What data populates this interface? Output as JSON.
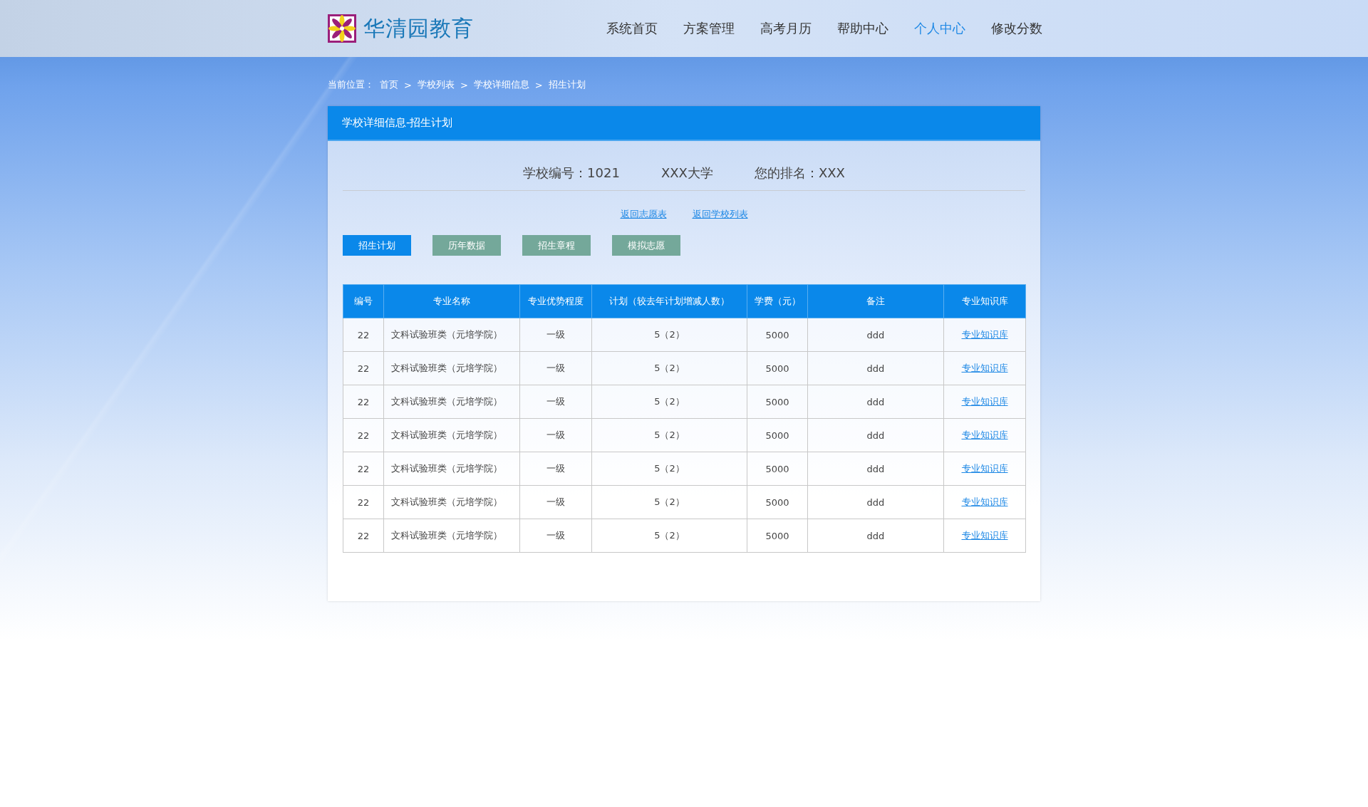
{
  "brand": {
    "name": "华清园教育"
  },
  "nav": [
    {
      "label": "系统首页",
      "selected": false
    },
    {
      "label": "方案管理",
      "selected": false
    },
    {
      "label": "高考月历",
      "selected": false
    },
    {
      "label": "帮助中心",
      "selected": false
    },
    {
      "label": "个人中心",
      "selected": true
    },
    {
      "label": "修改分数",
      "selected": false
    }
  ],
  "breadcrumb": {
    "prefix": "当前位置：",
    "items": [
      "首页",
      "学校列表",
      "学校详细信息",
      "招生计划"
    ],
    "separator": ">"
  },
  "panel": {
    "title": "学校详细信息-招生计划",
    "info": [
      "学校编号：1021",
      "XXX大学",
      "您的排名：XXX"
    ],
    "links": [
      "返回志愿表",
      "返回学校列表"
    ],
    "tabs": [
      {
        "label": "招生计划",
        "selected": true
      },
      {
        "label": "历年数据",
        "selected": false
      },
      {
        "label": "招生章程",
        "selected": false
      },
      {
        "label": "模拟志愿",
        "selected": false
      }
    ],
    "table": {
      "columns": [
        "编号",
        "专业名称",
        "专业优势程度",
        "计划（较去年计划增减人数）",
        "学费（元）",
        "备注",
        "专业知识库"
      ],
      "rows": [
        [
          "22",
          "文科试验班类（元培学院）",
          "一级",
          "5（2）",
          "5000",
          "ddd",
          "专业知识库"
        ],
        [
          "22",
          "文科试验班类（元培学院）",
          "一级",
          "5（2）",
          "5000",
          "ddd",
          "专业知识库"
        ],
        [
          "22",
          "文科试验班类（元培学院）",
          "一级",
          "5（2）",
          "5000",
          "ddd",
          "专业知识库"
        ],
        [
          "22",
          "文科试验班类（元培学院）",
          "一级",
          "5（2）",
          "5000",
          "ddd",
          "专业知识库"
        ],
        [
          "22",
          "文科试验班类（元培学院）",
          "一级",
          "5（2）",
          "5000",
          "ddd",
          "专业知识库"
        ],
        [
          "22",
          "文科试验班类（元培学院）",
          "一级",
          "5（2）",
          "5000",
          "ddd",
          "专业知识库"
        ],
        [
          "22",
          "文科试验班类（元培学院）",
          "一级",
          "5（2）",
          "5000",
          "ddd",
          "专业知识库"
        ]
      ]
    }
  }
}
